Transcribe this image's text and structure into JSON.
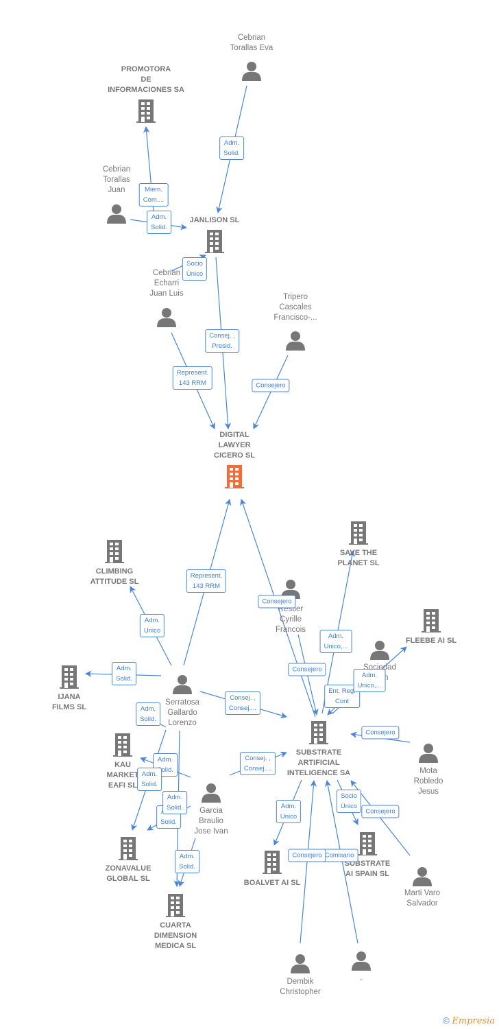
{
  "colors": {
    "accent": "#4a86d8",
    "node": "#777777",
    "main_node": "#f26b3a"
  },
  "nodes": [
    {
      "id": "eva",
      "type": "person",
      "label": "Cebrian\nTorallas Eva"
    },
    {
      "id": "promotora",
      "type": "company",
      "label": "PROMOTORA\nDE\nINFORMACIONES SA"
    },
    {
      "id": "juan",
      "type": "person",
      "label": "Cebrian\nTorallas\nJuan"
    },
    {
      "id": "janlison",
      "type": "company",
      "label": "JANLISON  SL"
    },
    {
      "id": "echarri",
      "type": "person",
      "label": "Cebrian\nEcharri\nJuan Luis"
    },
    {
      "id": "tripero",
      "type": "person",
      "label": "Tripero\nCascales\nFrancisco-..."
    },
    {
      "id": "digital",
      "type": "main",
      "label": "DIGITAL\nLAWYER\nCICERO  SL"
    },
    {
      "id": "climbing",
      "type": "company",
      "label": "CLIMBING\nATTITUDE  SL"
    },
    {
      "id": "save",
      "type": "company",
      "label": "SAVE THE\nPLANET  SL"
    },
    {
      "id": "restier",
      "type": "person",
      "label": "Restier\nCyrille\nFrancois"
    },
    {
      "id": "fleebe",
      "type": "company",
      "label": "FLEEBE AI  SL"
    },
    {
      "id": "sociedad",
      "type": "person",
      "label": "Sociedad\n...ion\n..."
    },
    {
      "id": "ijana",
      "type": "company",
      "label": "IJANA\nFILMS SL"
    },
    {
      "id": "serratosa",
      "type": "person",
      "label": "Serratosa\nGallardo\nLorenzo"
    },
    {
      "id": "substrate",
      "type": "company",
      "label": "SUBSTRATE\nARTIFICIAL\nINTELIGENCE SA"
    },
    {
      "id": "mota",
      "type": "person",
      "label": "Mota\nRobledo\nJesus"
    },
    {
      "id": "kau",
      "type": "company",
      "label": "KAU\nMARKET\nEAFI  SL"
    },
    {
      "id": "garcia",
      "type": "person",
      "label": "Garcia\nBraulio\nJose Ivan"
    },
    {
      "id": "zonavalue",
      "type": "company",
      "label": "ZONAVALUE\nGLOBAL  SL"
    },
    {
      "id": "boalvet",
      "type": "company",
      "label": "BOALVET AI  SL"
    },
    {
      "id": "spain",
      "type": "company",
      "label": "SUBSTRATE\nAI SPAIN  SL"
    },
    {
      "id": "marti",
      "type": "person",
      "label": "Marti Varo\nSalvador"
    },
    {
      "id": "cuarta",
      "type": "company",
      "label": "CUARTA\nDIMENSION\nMEDICA SL"
    },
    {
      "id": "dembik",
      "type": "person",
      "label": "Dembik\nChristopher"
    },
    {
      "id": "dash",
      "type": "person",
      "label": "-"
    }
  ],
  "edges": [
    {
      "from": "eva",
      "to": "janlison",
      "label": "Adm.\nSolid."
    },
    {
      "from": "juan",
      "to": "promotora",
      "label": "Miem.\nCom...."
    },
    {
      "from": "juan",
      "to": "janlison",
      "label": "Adm.\nSolid."
    },
    {
      "from": "echarri",
      "to": "janlison",
      "label": "Socio\nÚnico"
    },
    {
      "from": "janlison",
      "to": "digital",
      "label": "Consej. ,\nPresid."
    },
    {
      "from": "echarri",
      "to": "digital",
      "label": "Represent.\n143 RRM"
    },
    {
      "from": "tripero",
      "to": "digital",
      "label": "Consejero"
    },
    {
      "from": "serratosa",
      "to": "digital",
      "label": "Represent.\n143 RRM"
    },
    {
      "from": "substrate",
      "to": "digital",
      "label": "Consejero"
    },
    {
      "from": "serratosa",
      "to": "climbing",
      "label": "Adm.\nUnico"
    },
    {
      "from": "serratosa",
      "to": "ijana",
      "label": "Adm.\nSolid."
    },
    {
      "from": "serratosa",
      "to": "substrate",
      "label": "Consej. ,\nConsej...."
    },
    {
      "from": "restier",
      "to": "substrate",
      "label": "Consejero"
    },
    {
      "from": "substrate",
      "to": "save",
      "label": "Adm.\nUnico,..."
    },
    {
      "from": "sociedad",
      "to": "substrate",
      "label": "Ent.  Reg.\nCont"
    },
    {
      "from": "substrate",
      "to": "fleebe",
      "label": "Adm.\nUnico,..."
    },
    {
      "from": "mota",
      "to": "substrate",
      "label": "Consejero"
    },
    {
      "from": "garcia",
      "to": "substrate",
      "label": "Consej. ,\nConsej...."
    },
    {
      "from": "serratosa",
      "to": "kau",
      "label": "Adm.\nSolid."
    },
    {
      "from": "garcia",
      "to": "kau",
      "label": "Adm.\nSolid."
    },
    {
      "from": "serratosa",
      "to": "zonavalue",
      "label": "Adm.\nSolid."
    },
    {
      "from": "garcia",
      "to": "zonavalue",
      "label": "Adm.\nSolid."
    },
    {
      "from": "garcia",
      "to": "cuarta",
      "label": "Adm.\nSolid."
    },
    {
      "from": "serratosa",
      "to": "cuarta",
      "label": "Adm.\nSolid."
    },
    {
      "from": "substrate",
      "to": "boalvet",
      "label": "Adm.\nUnico"
    },
    {
      "from": "dash",
      "to": "substrate",
      "label": "Comisario"
    },
    {
      "from": "dembik",
      "to": "substrate",
      "label": "Consejero"
    },
    {
      "from": "substrate",
      "to": "spain",
      "label": "Socio\nÚnico"
    },
    {
      "from": "marti",
      "to": "substrate",
      "label": "Consejero"
    }
  ],
  "footer": {
    "copyright_symbol": "©",
    "brand": "Empresia"
  }
}
